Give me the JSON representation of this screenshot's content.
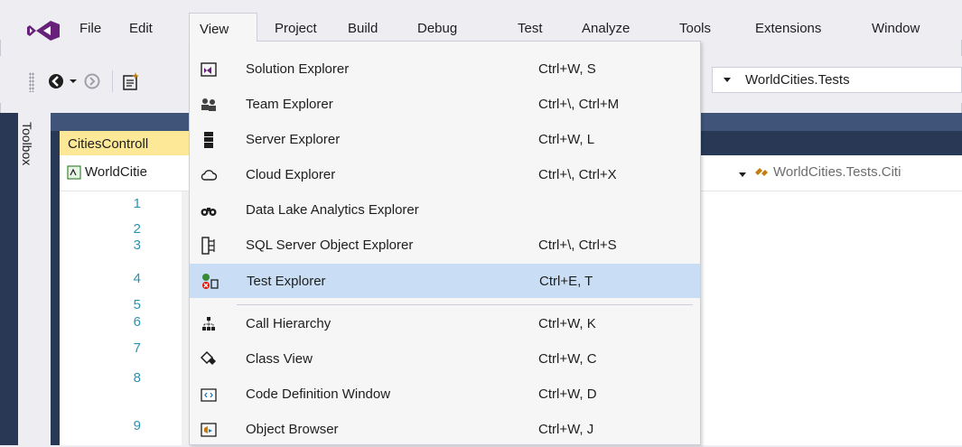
{
  "menubar": {
    "items": [
      "File",
      "Edit",
      "View",
      "Project",
      "Build",
      "Debug",
      "Test",
      "Analyze",
      "Tools",
      "Extensions",
      "Window"
    ],
    "active": "View"
  },
  "toolbar": {
    "startup_project": "WorldCities.Tests"
  },
  "toolbox": {
    "label": "Toolbox"
  },
  "editor": {
    "tab_title": "CitiesControll",
    "nav_project": "WorldCitie",
    "nav_member": "WorldCities.Tests.Citi",
    "line_numbers": [
      "1",
      "2",
      "3",
      "4",
      "5",
      "6",
      "7",
      "8",
      "9"
    ]
  },
  "view_menu": {
    "items": [
      {
        "icon": "solution-explorer-icon",
        "label": "Solution Explorer",
        "shortcut": "Ctrl+W, S"
      },
      {
        "icon": "team-explorer-icon",
        "label": "Team Explorer",
        "shortcut": "Ctrl+\\, Ctrl+M"
      },
      {
        "icon": "server-explorer-icon",
        "label": "Server Explorer",
        "shortcut": "Ctrl+W, L"
      },
      {
        "icon": "cloud-explorer-icon",
        "label": "Cloud Explorer",
        "shortcut": "Ctrl+\\, Ctrl+X"
      },
      {
        "icon": "data-lake-icon",
        "label": "Data Lake Analytics Explorer",
        "shortcut": ""
      },
      {
        "icon": "sql-server-icon",
        "label": "SQL Server Object Explorer",
        "shortcut": "Ctrl+\\, Ctrl+S"
      },
      {
        "icon": "test-explorer-icon",
        "label": "Test Explorer",
        "shortcut": "Ctrl+E, T",
        "highlighted": true
      },
      {
        "icon": "call-hierarchy-icon",
        "label": "Call Hierarchy",
        "shortcut": "Ctrl+W, K"
      },
      {
        "icon": "class-view-icon",
        "label": "Class View",
        "shortcut": "Ctrl+W, C"
      },
      {
        "icon": "code-definition-icon",
        "label": "Code Definition Window",
        "shortcut": "Ctrl+W, D"
      },
      {
        "icon": "object-browser-icon",
        "label": "Object Browser",
        "shortcut": "Ctrl+W, J"
      }
    ]
  },
  "colors": {
    "vs_purple": "#68217a",
    "highlight": "#c9def5",
    "tab_yellow": "#fce896",
    "line_number": "#2b91af"
  }
}
